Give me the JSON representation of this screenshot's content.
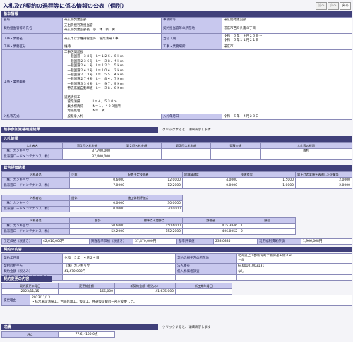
{
  "header": {
    "title": "入札及び契約の過程等に係る情報の公表（個別）",
    "nav": [
      "前へ",
      "次へ",
      "戻る"
    ]
  },
  "basic": {
    "section": "基本情報",
    "rows": [
      {
        "k1": "部局",
        "v1": "帯広開発建設部",
        "k2": "事務所等",
        "v2": "帯広開発建設部"
      },
      {
        "k1": "契約担当官等の氏名",
        "v1a": "支出負担行為担当官",
        "v1b": "帯広開発建設部長　小　林　新　男",
        "k2": "契約担当官等の所在地",
        "v2": "帯広市西５条南８丁目"
      },
      {
        "k1": "工事・業務名",
        "v1": "帯広市ほか維持管理外　管渠清掃工事",
        "k2": "当初工期",
        "v2a": "令和　５年　４月２５日～",
        "v2b": "令和　５年１１月２１日"
      },
      {
        "k1": "工事・業務区分",
        "v1": "維持",
        "k2": "工事・業務場所",
        "v2": "帯広市"
      }
    ],
    "overview_label": "工事・業務概要",
    "overview_lines": [
      "工事区間延長",
      "　一般国道　３８号　L＝１２６．６ｋｍ",
      "　一般国道２３６号　L＝　３８．４ｋｍ",
      "　一般国道２４１号　L＝１２２．５ｋｍ",
      "　一般国道２４２号　L＝１０４．２ｋｍ",
      "　一般国道２７３号　L＝　５５．４ｋｍ",
      "　一般国道２７４号　L＝　８４．７ｋｍ",
      "　一般国道３３６号　L＝　９７．９ｋｍ",
      "　帯広広尾自動車道　L＝　５８．６ｋｍ",
      "",
      "道路清掃工",
      "　管渠清掃　　　　L＝４，５３０ｍ",
      "　集水桝清掃　　　N＝１，４００箇所",
      "　汚泥処理　　　　N＝１式"
    ],
    "bid_method_label": "入札等方式",
    "bid_method": "一般競争入札",
    "bid_date_label": "入札年月日",
    "bid_date": "令和　５年　４月２０日"
  },
  "qualification": {
    "section": "競争参加資格確認結果",
    "hint": "クリックすると、詳細表示します"
  },
  "bid_result": {
    "section": "入札結果",
    "headers": [
      "入札者名",
      "第１回入札金額",
      "第２回入札金額",
      "第３回入札金額",
      "見積金額",
      "入札等の経過"
    ],
    "rows": [
      [
        "（株）カンキョウ",
        "37,700,000",
        "",
        "",
        "",
        "落札"
      ],
      [
        "北海道ロードメンテナンス（株）",
        "37,400,000",
        "",
        "",
        "",
        ""
      ]
    ]
  },
  "eval": {
    "section": "総合評価結果",
    "t1_headers": [
      "入札者名",
      "企業",
      "配置予定技術者",
      "地域精通度",
      "技術提案",
      "賃上げの実施を表明した企業等"
    ],
    "t1_rows": [
      [
        "（株）カンキョウ",
        "0.6000",
        "12.0000",
        "4.0000",
        "1.5000",
        "2.0000"
      ],
      [
        "北海道ロードメンテナンス（株）",
        "7.0000",
        "12.2000",
        "0.0000",
        "1.0000",
        "2.0000"
      ]
    ],
    "t2_headers": [
      "入札者名",
      "週休",
      "施工体制評価点"
    ],
    "t2_rows": [
      [
        "（株）カンキョウ",
        "0.0000",
        "30.0000"
      ],
      [
        "北海道ロードメンテナンス（株）",
        "0.0000",
        "30.0000"
      ]
    ],
    "t3_headers": [
      "入札者名",
      "合計",
      "標準点＋加算点",
      "評価値",
      "順位"
    ],
    "t3_rows": [
      [
        "（株）カンキョウ",
        "50.6000",
        "150.6000",
        "415.3846",
        "1"
      ],
      [
        "北海道ロードメンテナンス（株）",
        "52.2000",
        "152.2000",
        "406.0052",
        "2"
      ]
    ],
    "prices": [
      {
        "k": "予定価格（税抜き）",
        "v": "42,010,000円"
      },
      {
        "k": "調査基準価格（税抜き）",
        "v": "37,470,000円"
      },
      {
        "k": "基準評価値",
        "v": "238.0385"
      },
      {
        "k": "活用福利費確保額",
        "v": "1,966,068円"
      }
    ]
  },
  "contract": {
    "section": "契約の内容",
    "rows": [
      {
        "k1": "契約年月日",
        "v1": "令和　５年　４月２４日",
        "k2": "契約の相手方の所在地",
        "v2a": "北海道上川郡新得町字新得基１線３２",
        "v2b": "－８"
      },
      {
        "k1": "契約の相手方",
        "v1": "（株）カンキョウ",
        "k2": "法人番号",
        "v2": "6460101003131"
      },
      {
        "k1": "契約金額（税込み）",
        "v1": "41,470,000円",
        "k2": "低入札価格調査",
        "v2": "なし"
      },
      {
        "k1": "随意契約によることとした理由",
        "v1": "",
        "k2": "",
        "v2": ""
      }
    ]
  },
  "change": {
    "section": "契約変更の内容",
    "headers": [
      "契約変更年月日",
      "変更前金額",
      "新契約金額（税込み）",
      "新工期年月日"
    ],
    "row": [
      "2023/11/15",
      "165,000",
      "41,635,000",
      ""
    ],
    "reason_label": "変更理由",
    "reason_lines": [
      "2023/11/13",
      "・排水施設清掃工、汚泥処理工、仮設工、共通仮設費の一部を変更した。"
    ]
  },
  "grade": {
    "section": "成績",
    "hint": "クリックすると、詳細表示します",
    "label": "評点",
    "value": "77.6／100.0点"
  }
}
